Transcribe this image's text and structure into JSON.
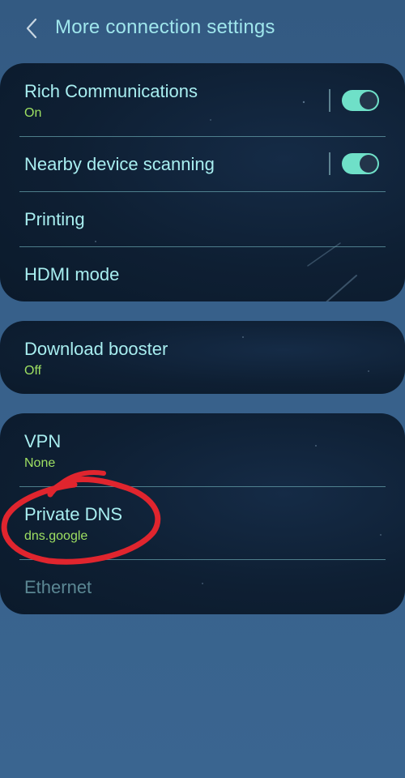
{
  "header": {
    "title": "More connection settings"
  },
  "card1": {
    "rich_communications": {
      "label": "Rich Communications",
      "status": "On",
      "toggle_on": true
    },
    "nearby_device_scanning": {
      "label": "Nearby device scanning",
      "toggle_on": true
    },
    "printing": {
      "label": "Printing"
    },
    "hdmi_mode": {
      "label": "HDMI mode"
    }
  },
  "card2": {
    "download_booster": {
      "label": "Download booster",
      "status": "Off"
    }
  },
  "card3": {
    "vpn": {
      "label": "VPN",
      "status": "None"
    },
    "private_dns": {
      "label": "Private DNS",
      "status": "dns.google"
    },
    "ethernet": {
      "label": "Ethernet",
      "disabled": true
    }
  },
  "colors": {
    "title_text": "#a8eef0",
    "status_text": "#9ee062",
    "toggle_on": "#6fe0c8",
    "annotation_circle": "#e0252e"
  },
  "icons": {
    "back": "chevron-left-icon"
  }
}
